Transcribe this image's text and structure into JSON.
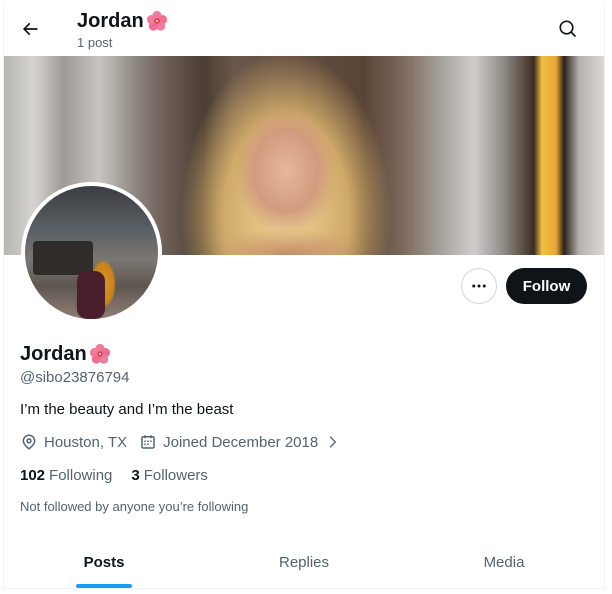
{
  "header": {
    "title": "Jordan",
    "subtitle": "1 post"
  },
  "profile": {
    "name": "Jordan",
    "handle": "@sibo23876794",
    "bio": "I’m the beauty and I’m the beast",
    "location": "Houston, TX",
    "joined": "Joined December 2018"
  },
  "actions": {
    "follow_label": "Follow"
  },
  "stats": {
    "following_count": "102",
    "following_label": "Following",
    "followers_count": "3",
    "followers_label": "Followers"
  },
  "followed_note": "Not followed by anyone you’re following",
  "tabs": [
    {
      "label": "Posts",
      "active": true
    },
    {
      "label": "Replies",
      "active": false
    },
    {
      "label": "Media",
      "active": false
    }
  ],
  "icons": {
    "back": "arrow-left-icon",
    "search": "search-icon",
    "more": "more-horizontal-icon",
    "location": "location-pin-icon",
    "calendar": "calendar-icon",
    "chevron": "chevron-right-icon",
    "emoji": "hibiscus-icon"
  },
  "colors": {
    "primary_text": "#0f1419",
    "secondary_text": "#536471",
    "accent": "#1d9bf0",
    "follow_button": "#0f1419"
  }
}
